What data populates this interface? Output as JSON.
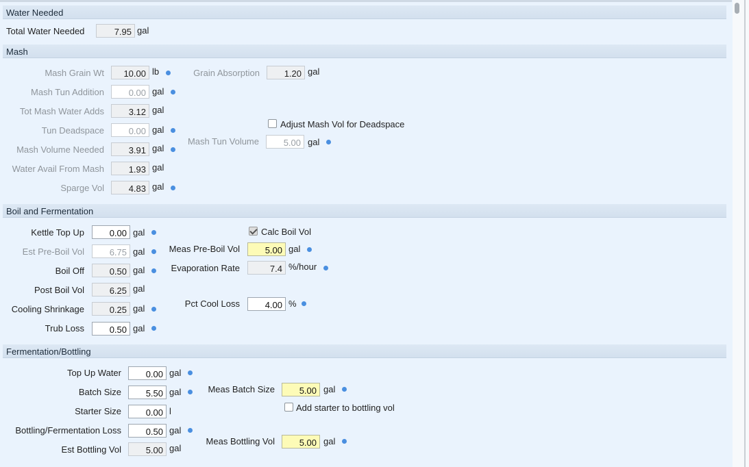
{
  "water_needed": {
    "header": "Water Needed",
    "total_label": "Total Water Needed",
    "total_value": "7.95",
    "total_unit": "gal"
  },
  "mash": {
    "header": "Mash",
    "grain_wt_label": "Mash Grain Wt",
    "grain_wt_value": "10.00",
    "grain_wt_unit": "lb",
    "grain_abs_label": "Grain Absorption",
    "grain_abs_value": "1.20",
    "grain_abs_unit": "gal",
    "tun_add_label": "Mash Tun Addition",
    "tun_add_value": "0.00",
    "tun_add_unit": "gal",
    "tot_adds_label": "Tot Mash Water Adds",
    "tot_adds_value": "3.12",
    "tot_adds_unit": "gal",
    "deadspace_label": "Tun Deadspace",
    "deadspace_value": "0.00",
    "deadspace_unit": "gal",
    "adjust_label": "Adjust Mash Vol for Deadspace",
    "adjust_checked": false,
    "vol_needed_label": "Mash Volume Needed",
    "vol_needed_value": "3.91",
    "vol_needed_unit": "gal",
    "tun_vol_label": "Mash Tun Volume",
    "tun_vol_value": "5.00",
    "tun_vol_unit": "gal",
    "avail_label": "Water Avail From Mash",
    "avail_value": "1.93",
    "avail_unit": "gal",
    "sparge_label": "Sparge Vol",
    "sparge_value": "4.83",
    "sparge_unit": "gal"
  },
  "boil": {
    "header": "Boil and Fermentation",
    "kettle_label": "Kettle Top Up",
    "kettle_value": "0.00",
    "kettle_unit": "gal",
    "calc_label": "Calc Boil Vol",
    "calc_checked": true,
    "est_pre_label": "Est Pre-Boil Vol",
    "est_pre_value": "6.75",
    "est_pre_unit": "gal",
    "meas_pre_label": "Meas Pre-Boil Vol",
    "meas_pre_value": "5.00",
    "meas_pre_unit": "gal",
    "boil_off_label": "Boil Off",
    "boil_off_value": "0.50",
    "boil_off_unit": "gal",
    "evap_label": "Evaporation Rate",
    "evap_value": "7.4",
    "evap_unit": "%/hour",
    "post_label": "Post Boil Vol",
    "post_value": "6.25",
    "post_unit": "gal",
    "cool_label": "Cooling Shrinkage",
    "cool_value": "0.25",
    "cool_unit": "gal",
    "pct_label": "Pct Cool Loss",
    "pct_value": "4.00",
    "pct_unit": "%",
    "trub_label": "Trub Loss",
    "trub_value": "0.50",
    "trub_unit": "gal"
  },
  "ferm": {
    "header": "Fermentation/Bottling",
    "topup_label": "Top Up Water",
    "topup_value": "0.00",
    "topup_unit": "gal",
    "batch_label": "Batch Size",
    "batch_value": "5.50",
    "batch_unit": "gal",
    "meas_batch_label": "Meas Batch Size",
    "meas_batch_value": "5.00",
    "meas_batch_unit": "gal",
    "starter_label": "Starter Size",
    "starter_value": "0.00",
    "starter_unit": "l",
    "add_starter_label": "Add starter to bottling vol",
    "add_starter_checked": false,
    "loss_label": "Bottling/Fermentation Loss",
    "loss_value": "0.50",
    "loss_unit": "gal",
    "est_bottling_label": "Est Bottling Vol",
    "est_bottling_value": "5.00",
    "est_bottling_unit": "gal",
    "meas_bottling_label": "Meas Bottling Vol",
    "meas_bottling_value": "5.00",
    "meas_bottling_unit": "gal"
  },
  "colors": {
    "background": "#eaf3fd",
    "section_header": "#d8e4f1",
    "measured_field": "#fdfbb7",
    "info_dot": "#4a8fe0"
  },
  "icons": {
    "info_dot": "info-dot-icon",
    "checkbox": "checkbox-icon",
    "scrollbar": "scrollbar-thumb"
  }
}
